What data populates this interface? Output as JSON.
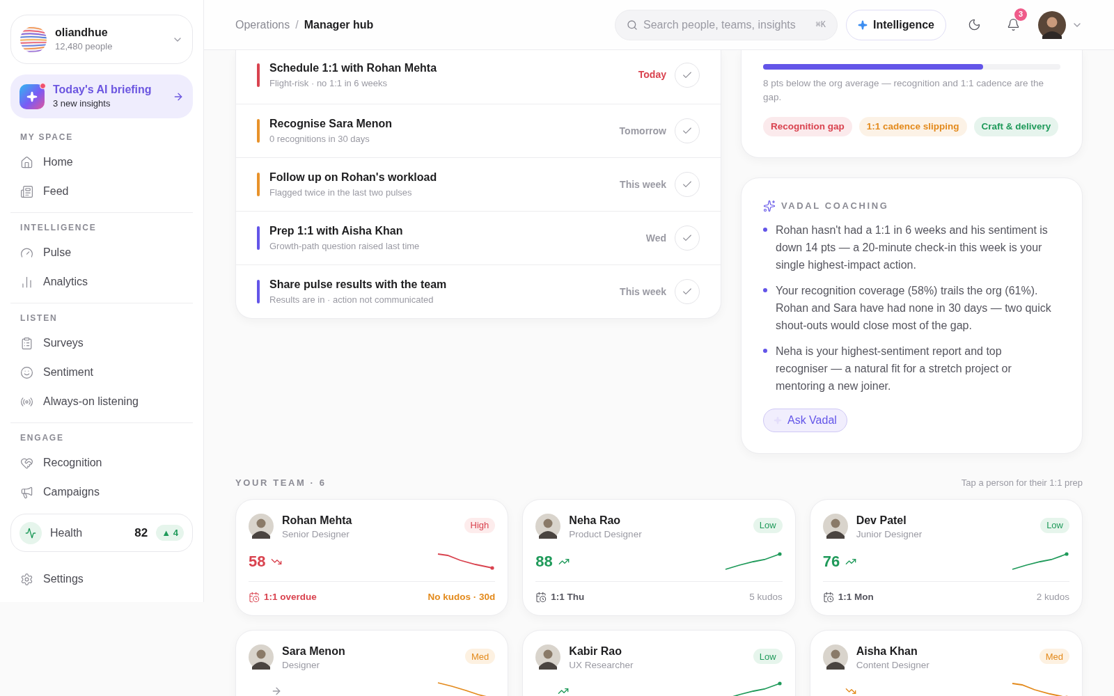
{
  "org": {
    "name": "oliandhue",
    "people": "12,480 people"
  },
  "briefing": {
    "title": "Today's AI briefing",
    "subtitle": "3 new insights"
  },
  "nav_sections": [
    {
      "heading": "MY SPACE",
      "items": [
        {
          "label": "Home",
          "selected": false
        },
        {
          "label": "Feed",
          "selected": false
        }
      ]
    },
    {
      "heading": "INTELLIGENCE",
      "items": [
        {
          "label": "Pulse",
          "selected": false
        },
        {
          "label": "Analytics",
          "selected": false
        }
      ]
    },
    {
      "heading": "LISTEN",
      "items": [
        {
          "label": "Surveys",
          "selected": false
        },
        {
          "label": "Sentiment",
          "selected": false
        },
        {
          "label": "Always-on listening",
          "selected": false
        }
      ]
    },
    {
      "heading": "ENGAGE",
      "items": [
        {
          "label": "Recognition",
          "selected": false
        },
        {
          "label": "Campaigns",
          "selected": false
        }
      ]
    }
  ],
  "health": {
    "label": "Health",
    "score": "82",
    "delta": "▲ 4"
  },
  "settings": {
    "label": "Settings"
  },
  "breadcrumb": {
    "items": [
      "Operations",
      "Manager hub"
    ],
    "separator": "/"
  },
  "search": {
    "placeholder": "Search people, teams, insights",
    "shortcut": "⌘K"
  },
  "intelligence_button": "Intelligence",
  "notifications": {
    "count": "3"
  },
  "tasks": [
    {
      "title": "Schedule 1:1 with Rohan Mehta",
      "detail": "Flight-risk · no 1:1 in 6 weeks",
      "due": "Today",
      "color": "#d9434f",
      "overdue": true
    },
    {
      "title": "Recognise Sara Menon",
      "detail": "0 recognitions in 30 days",
      "due": "Tomorrow",
      "color": "#e8922a",
      "overdue": false
    },
    {
      "title": "Follow up on Rohan's workload",
      "detail": "Flagged twice in the last two pulses",
      "due": "This week",
      "color": "#e8922a",
      "overdue": false
    },
    {
      "title": "Prep 1:1 with Aisha Khan",
      "detail": "Growth-path question raised last time",
      "due": "Wed",
      "color": "#6355e8",
      "overdue": false
    },
    {
      "title": "Share pulse results with the team",
      "detail": "Results are in · action not communicated",
      "due": "This week",
      "color": "#6355e8",
      "overdue": false
    }
  ],
  "team_health": {
    "level": 0.74,
    "note": "8 pts below the org average — recognition and 1:1 cadence are the gap.",
    "tags": [
      {
        "label": "Recognition gap",
        "color": "#d9434f"
      },
      {
        "label": "1:1 cadence slipping",
        "color": "#e38a1c"
      },
      {
        "label": "Craft & delivery",
        "color": "#1f9a5a"
      }
    ]
  },
  "coaching": {
    "title": "VADAL COACHING",
    "bullets": [
      "Rohan hasn't had a 1:1 in 6 weeks and his sentiment is down 14 pts — a 20-minute check-in this week is your single highest-impact action.",
      "Your recognition coverage (58%) trails the org (61%). Rohan and Sara have had none in 30 days — two quick shout-outs would close most of the gap.",
      "Neha is your highest-sentiment report and top recogniser — a natural fit for a stretch project or mentoring a new joiner."
    ],
    "button": "Ask Vadal"
  },
  "team": {
    "title": "YOUR TEAM · 6",
    "hint": "Tap a person for their 1:1 prep",
    "members": [
      {
        "name": "Rohan Mehta",
        "role": "Senior Designer",
        "risk": {
          "label": "High",
          "kind": "high"
        },
        "score": "58",
        "trend": {
          "kind": "down"
        },
        "one_on_one": "1:1 overdue",
        "one_on_one_overdue": true,
        "kudos": "No kudos · 30d",
        "kudos_warning": true
      },
      {
        "name": "Neha Rao",
        "role": "Product Designer",
        "risk": {
          "label": "Low",
          "kind": "low"
        },
        "score": "88",
        "trend": {
          "kind": "up"
        },
        "one_on_one": "1:1 Thu",
        "one_on_one_overdue": false,
        "kudos": "5 kudos",
        "kudos_warning": false
      },
      {
        "name": "Dev Patel",
        "role": "Junior Designer",
        "risk": {
          "label": "Low",
          "kind": "low"
        },
        "score": "76",
        "trend": {
          "kind": "up"
        },
        "one_on_one": "1:1 Mon",
        "one_on_one_overdue": false,
        "kudos": "2 kudos",
        "kudos_warning": false
      },
      {
        "name": "Sara Menon",
        "role": "Designer",
        "risk": {
          "label": "Med",
          "kind": "med"
        },
        "trend": {
          "kind": "flat"
        }
      },
      {
        "name": "Kabir Rao",
        "role": "UX Researcher",
        "risk": {
          "label": "Low",
          "kind": "low"
        },
        "trend": {
          "kind": "up"
        }
      },
      {
        "name": "Aisha Khan",
        "role": "Content Designer",
        "risk": {
          "label": "Med",
          "kind": "med"
        },
        "trend": {
          "kind": "down"
        }
      }
    ]
  }
}
